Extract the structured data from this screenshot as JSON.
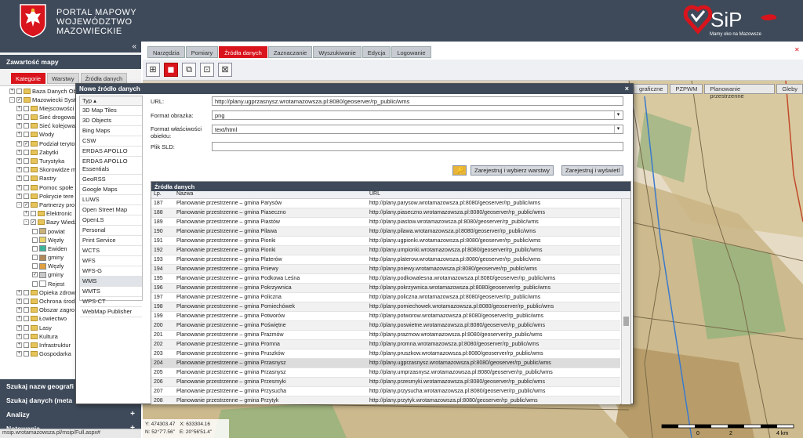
{
  "header": {
    "title_lines": [
      "PORTAL MAPOWY",
      "WOJEWÓDZTWO",
      "MAZOWIECKIE"
    ],
    "sip_logo_text": "SiP",
    "sip_tagline": "Mamy oko na Mazowsze"
  },
  "left_panel": {
    "collapse_glyph": "«",
    "title": "Zawartość mapy",
    "tabs": [
      "Kategorie",
      "Warstwy",
      "Źródła danych"
    ],
    "tree": [
      {
        "indent": 0,
        "exp": "+",
        "checked": false,
        "label": "Baza Danych Ob"
      },
      {
        "indent": 0,
        "exp": "-",
        "checked": true,
        "label": "Mazowiecki System"
      },
      {
        "indent": 1,
        "exp": "+",
        "checked": false,
        "label": "Miejscowości"
      },
      {
        "indent": 1,
        "exp": "+",
        "checked": false,
        "label": "Sieć drogowa"
      },
      {
        "indent": 1,
        "exp": "+",
        "checked": false,
        "label": "Sieć kolejowa"
      },
      {
        "indent": 1,
        "exp": "+",
        "checked": false,
        "label": "Wody"
      },
      {
        "indent": 1,
        "exp": "+",
        "checked": true,
        "label": "Podział teryto"
      },
      {
        "indent": 1,
        "exp": "+",
        "checked": false,
        "label": "Zabytki"
      },
      {
        "indent": 1,
        "exp": "+",
        "checked": false,
        "label": "Turystyka"
      },
      {
        "indent": 1,
        "exp": "+",
        "checked": false,
        "label": "Skorowidze m"
      },
      {
        "indent": 1,
        "exp": "+",
        "checked": false,
        "label": "Rastry"
      },
      {
        "indent": 1,
        "exp": "+",
        "checked": false,
        "label": "Pomoc społe"
      },
      {
        "indent": 1,
        "exp": "+",
        "checked": false,
        "label": "Pokrycie tere"
      },
      {
        "indent": 1,
        "exp": "-",
        "checked": true,
        "label": "Partnerzy pro"
      },
      {
        "indent": 2,
        "exp": "+",
        "checked": false,
        "label": "Elektronic"
      },
      {
        "indent": 2,
        "exp": "-",
        "checked": true,
        "label": "Bazy Wiedz"
      },
      {
        "indent": 3,
        "swatch": "#c9b27a",
        "checked": false,
        "label": "powiat"
      },
      {
        "indent": 3,
        "swatch": "#e8d46a",
        "checked": false,
        "label": "Węzły"
      },
      {
        "indent": 3,
        "swatch": "#3cb39a",
        "checked": false,
        "label": "Ewiden"
      },
      {
        "indent": 3,
        "swatch": "#b08a5a",
        "checked": false,
        "label": "gminy"
      },
      {
        "indent": 3,
        "swatch": "#e0a040",
        "checked": false,
        "label": "Węzły"
      },
      {
        "indent": 3,
        "swatch": "#c8c8c8",
        "checked": true,
        "label": "gminy"
      },
      {
        "indent": 3,
        "swatch": "#ffffff",
        "checked": false,
        "label": "Rejest"
      },
      {
        "indent": 1,
        "exp": "+",
        "checked": false,
        "label": "Opieka zdrow"
      },
      {
        "indent": 1,
        "exp": "+",
        "checked": false,
        "label": "Ochrona środ"
      },
      {
        "indent": 1,
        "exp": "+",
        "checked": false,
        "label": "Obszar zagro"
      },
      {
        "indent": 1,
        "exp": "+",
        "checked": false,
        "label": "Łowiectwo"
      },
      {
        "indent": 1,
        "exp": "+",
        "checked": false,
        "label": "Lasy"
      },
      {
        "indent": 1,
        "exp": "+",
        "checked": false,
        "label": "Kultura"
      },
      {
        "indent": 1,
        "exp": "+",
        "checked": false,
        "label": "Infrastruktur"
      },
      {
        "indent": 1,
        "exp": "+",
        "checked": false,
        "label": "Gospodarka"
      }
    ],
    "sections": [
      "Szukaj nazw geografi",
      "Szukaj danych (meta",
      "Analizy",
      "Notowania"
    ],
    "status_url": "msip.wrotamazowsza.pl/msip/Full.aspx#"
  },
  "menu_tabs": [
    "Narzędzia",
    "Pomiary",
    "Źródła danych",
    "Zaznaczanie",
    "Wyszukiwanie",
    "Edycja",
    "Logowanie"
  ],
  "active_menu_tab": 2,
  "tool_icons": [
    "⊞",
    "◼",
    "⧉",
    "⊡",
    "⊠"
  ],
  "layer_tabs": [
    "graficzne",
    "PZPWM",
    "Planowanie przestrzenne",
    "Gleby"
  ],
  "coords": {
    "y": "Y: 474303.47",
    "x": "X: 633304.16",
    "n": "N: 52°7'7.56\"",
    "e": "E: 20°56'51.4\""
  },
  "scale_labels": [
    "0",
    "2",
    "4 km"
  ],
  "dialog": {
    "title": "Nowe źródło danych",
    "close_glyph": "×",
    "type_header": "Typ ▴",
    "types": [
      "3D Map Tiles",
      "3D Objects",
      "Bing Maps",
      "CSW",
      "ERDAS APOLLO",
      "ERDAS APOLLO Essentials",
      "GeoRSS",
      "Google Maps",
      "LUWS",
      "Open Street Map",
      "OpenLS",
      "Personal",
      "Print Service",
      "WCTS",
      "WFS",
      "WFS-G",
      "WMS",
      "WMTS",
      "WPS-CT",
      "WebMap Publisher"
    ],
    "selected_type": 16,
    "url_label": "URL:",
    "url_value": "http://plany.ugprzasnysz.wrotamazowsza.pl:8080/geoserver/rp_public/wms",
    "format_label": "Format obrazka:",
    "format_value": "png",
    "feature_format_label": "Format właściwości obiektu:",
    "feature_format_value": "text/html",
    "sld_label": "Plik SLD:",
    "sld_value": "",
    "btn_register_choose": "Zarejestruj i wybierz warstwy",
    "btn_register_show": "Zarejestruj i wyświetl",
    "sources_title": "Źródła danych",
    "col_lp": "Lp.",
    "col_name": "Nazwa",
    "col_url": "URL",
    "rows": [
      {
        "lp": "187",
        "name": "Planowanie przestrzenne – gmina Parysów",
        "url": "http://plany.parysow.wrotamazowsza.pl:8080/geoserver/rp_public/wms"
      },
      {
        "lp": "188",
        "name": "Planowanie przestrzenne – gmina Piaseczno",
        "url": "http://plany.piaseczno.wrotamazowsza.pl:8080/geoserver/rp_public/wms"
      },
      {
        "lp": "189",
        "name": "Planowanie przestrzenne – gmina Piastów",
        "url": "http://plany.piastow.wrotamazowsza.pl:8080/geoserver/rp_public/wms"
      },
      {
        "lp": "190",
        "name": "Planowanie przestrzenne – gmina Pilawa",
        "url": "http://plany.pilawa.wrotamazowsza.pl:8080/geoserver/rp_public/wms"
      },
      {
        "lp": "191",
        "name": "Planowanie przestrzenne – gmina Pionki",
        "url": "http://plany.ugpionki.wrotamazowsza.pl:8080/geoserver/rp_public/wms"
      },
      {
        "lp": "192",
        "name": "Planowanie przestrzenne – gmina Pionki",
        "url": "http://plany.umpionki.wrotamazowsza.pl:8080/geoserver/rp_public/wms"
      },
      {
        "lp": "193",
        "name": "Planowanie przestrzenne – gmina Platerów",
        "url": "http://plany.platerow.wrotamazowsza.pl:8080/geoserver/rp_public/wms"
      },
      {
        "lp": "194",
        "name": "Planowanie przestrzenne – gmina Pniewy",
        "url": "http://plany.pniewy.wrotamazowsza.pl:8080/geoserver/rp_public/wms"
      },
      {
        "lp": "195",
        "name": "Planowanie przestrzenne – gmina Podkowa Leśna",
        "url": "http://plany.podkowalesna.wrotamazowsza.pl:8080/geoserver/rp_public/wms"
      },
      {
        "lp": "196",
        "name": "Planowanie przestrzenne – gmina Pokrzywnica",
        "url": "http://plany.pokrzywnica.wrotamazowsza.pl:8080/geoserver/rp_public/wms"
      },
      {
        "lp": "197",
        "name": "Planowanie przestrzenne – gmina Policzna",
        "url": "http://plany.policzna.wrotamazowsza.pl:8080/geoserver/rp_public/wms"
      },
      {
        "lp": "198",
        "name": "Planowanie przestrzenne – gmina Pomiechówek",
        "url": "http://plany.pomiechowek.wrotamazowsza.pl:8080/geoserver/rp_public/wms"
      },
      {
        "lp": "199",
        "name": "Planowanie przestrzenne – gmina Potworów",
        "url": "http://plany.potworow.wrotamazowsza.pl:8080/geoserver/rp_public/wms"
      },
      {
        "lp": "200",
        "name": "Planowanie przestrzenne – gmina Poświętne",
        "url": "http://plany.poswietne.wrotamazowsza.pl:8080/geoserver/rp_public/wms"
      },
      {
        "lp": "201",
        "name": "Planowanie przestrzenne – gmina Prażmów",
        "url": "http://plany.prazmow.wrotamazowsza.pl:8080/geoserver/rp_public/wms"
      },
      {
        "lp": "202",
        "name": "Planowanie przestrzenne – gmina Promna",
        "url": "http://plany.promna.wrotamazowsza.pl:8080/geoserver/rp_public/wms"
      },
      {
        "lp": "203",
        "name": "Planowanie przestrzenne – gmina Pruszków",
        "url": "http://plany.pruszkow.wrotamazowsza.pl:8080/geoserver/rp_public/wms"
      },
      {
        "lp": "204",
        "name": "Planowanie przestrzenne – gmina Przasnysz",
        "url": "http://plany.ugprzasnysz.wrotamazowsza.pl:8080/geoserver/rp_public/wms"
      },
      {
        "lp": "205",
        "name": "Planowanie przestrzenne – gmina Przasnysz",
        "url": "http://plany.umprzasnysz.wrotamazowsza.pl:8080/geoserver/rp_public/wms"
      },
      {
        "lp": "206",
        "name": "Planowanie przestrzenne – gmina Przesmyki",
        "url": "http://plany.przesmyki.wrotamazowsza.pl:8080/geoserver/rp_public/wms"
      },
      {
        "lp": "207",
        "name": "Planowanie przestrzenne – gmina Przysucha",
        "url": "http://plany.przysucha.wrotamazowsza.pl:8080/geoserver/rp_public/wms"
      },
      {
        "lp": "208",
        "name": "Planowanie przestrzenne – gmina Przytyk",
        "url": "http://plany.przytyk.wrotamazowsza.pl:8080/geoserver/rp_public/wms"
      }
    ],
    "highlighted_row": 17
  },
  "colors": {
    "accent": "#d9141c",
    "header": "#3e4a5a"
  }
}
